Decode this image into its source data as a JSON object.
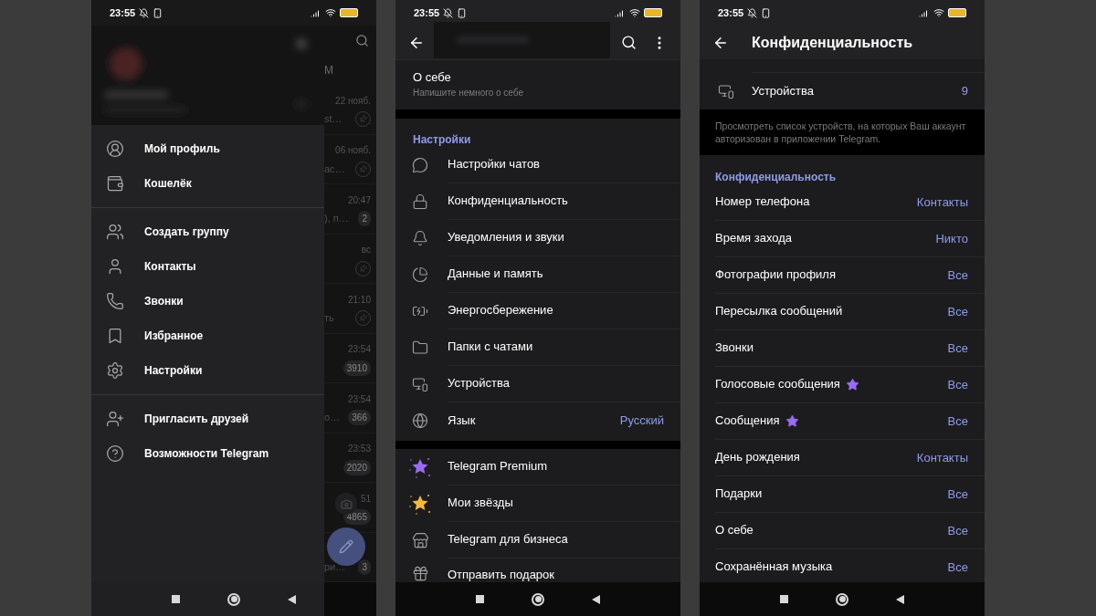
{
  "drawer_screen": {
    "status_bar": {
      "time": "23:55"
    },
    "menu_sections": [
      [
        "Мой профиль",
        "Кошелёк"
      ],
      [
        "Создать группу",
        "Контакты",
        "Звонки",
        "Избранное",
        "Настройки"
      ],
      [
        "Пригласить друзей",
        "Возможности Telegram"
      ]
    ],
    "chat_list": {
      "tab_fragment": "М",
      "rows": [
        {
          "time": "22 нояб.",
          "preview": "st…",
          "pinned": true
        },
        {
          "time": "06 нояб.",
          "preview": "ас…",
          "pinned": true
        },
        {
          "time": "20:47",
          "preview": "), п…",
          "badge": "2",
          "pinned": false
        },
        {
          "time": "вс",
          "pinned": true
        },
        {
          "time": "21:10",
          "preview": "ть",
          "pinned": true
        },
        {
          "time": "23:54",
          "badge": "3910",
          "pinned": false
        },
        {
          "time": "23:54",
          "preview": "о…",
          "badge": "366",
          "pinned": false
        },
        {
          "time": "23:53",
          "badge": "2020",
          "pinned": false
        },
        {
          "time": "51",
          "badge": "4865",
          "pinned": false
        },
        {
          "preview": "ри…",
          "badge": "3",
          "pinned": false
        }
      ]
    }
  },
  "settings_screen": {
    "status_bar": {
      "time": "23:55"
    },
    "about": {
      "title": "О себе",
      "hint": "Напишите немного о себе"
    },
    "section_title": "Настройки",
    "items": [
      {
        "label": "Настройки чатов"
      },
      {
        "label": "Конфиденциальность"
      },
      {
        "label": "Уведомления и звуки"
      },
      {
        "label": "Данные и память"
      },
      {
        "label": "Энергосбережение"
      },
      {
        "label": "Папки с чатами"
      },
      {
        "label": "Устройства"
      },
      {
        "label": "Язык",
        "value": "Русский"
      }
    ],
    "extra_items": [
      {
        "label": "Telegram Premium"
      },
      {
        "label": "Мои звёзды"
      },
      {
        "label": "Telegram для бизнеса"
      },
      {
        "label": "Отправить подарок"
      }
    ]
  },
  "privacy_screen": {
    "status_bar": {
      "time": "23:55"
    },
    "title": "Конфиденциальность",
    "devices": {
      "label": "Устройства",
      "value": "9"
    },
    "devices_note": "Просмотреть список устройств, на которых Ваш аккаунт авторизован в приложении Telegram.",
    "section_title": "Конфиденциальность",
    "rows": [
      {
        "label": "Номер телефона",
        "value": "Контакты",
        "premium": false
      },
      {
        "label": "Время захода",
        "value": "Никто",
        "premium": false
      },
      {
        "label": "Фотографии профиля",
        "value": "Все",
        "premium": false
      },
      {
        "label": "Пересылка сообщений",
        "value": "Все",
        "premium": false
      },
      {
        "label": "Звонки",
        "value": "Все",
        "premium": false
      },
      {
        "label": "Голосовые сообщения",
        "value": "Все",
        "premium": true
      },
      {
        "label": "Сообщения",
        "value": "Все",
        "premium": true
      },
      {
        "label": "День рождения",
        "value": "Контакты",
        "premium": false
      },
      {
        "label": "Подарки",
        "value": "Все",
        "premium": false
      },
      {
        "label": "О себе",
        "value": "Все",
        "premium": false
      },
      {
        "label": "Сохранённая музыка",
        "value": "Все",
        "premium": false
      }
    ]
  }
}
